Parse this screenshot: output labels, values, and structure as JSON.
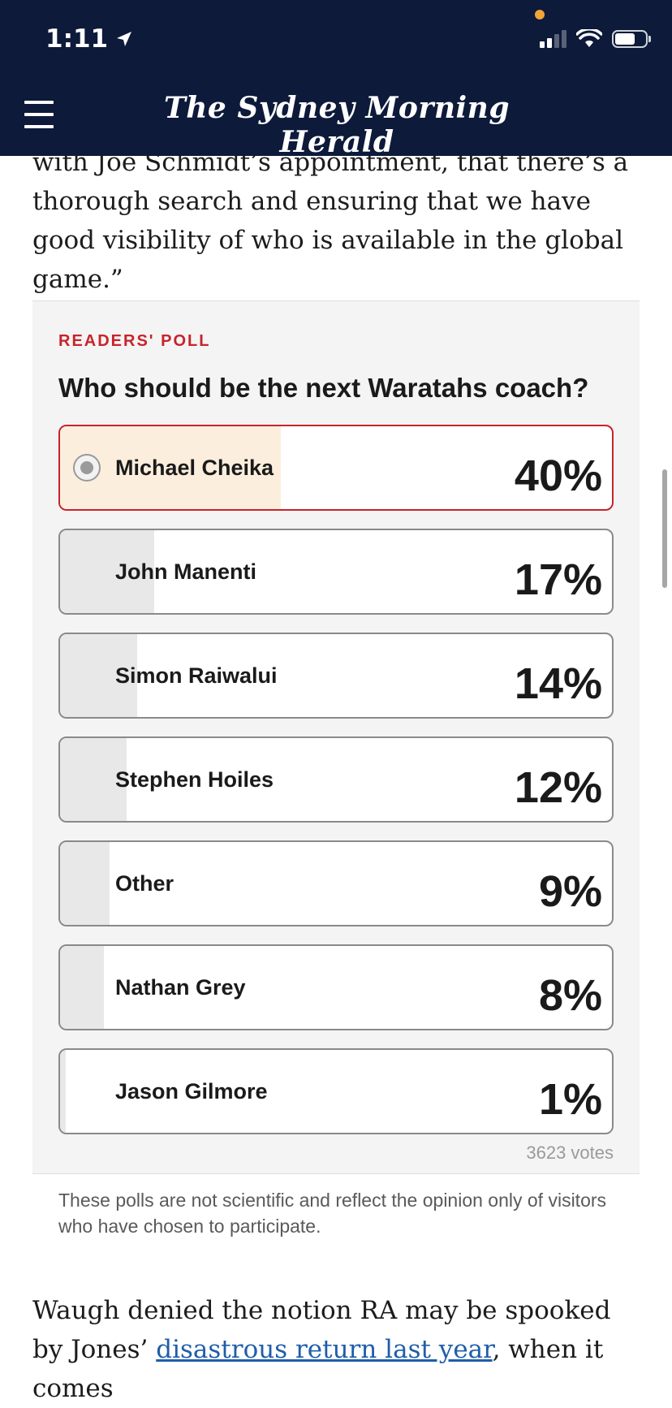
{
  "status_bar": {
    "time": "1:11"
  },
  "header": {
    "masthead": "The Sydney Morning Herald"
  },
  "article": {
    "top_text": "with Joe Schmidt’s appointment, that there’s a thorough search and ensuring that we have good visibility of who is available in the global game.”",
    "bottom_text_before": "Waugh denied the notion RA may be spooked by Jones’ ",
    "bottom_link": "disastrous return last year",
    "bottom_text_after": ", when it comes"
  },
  "poll": {
    "kicker": "READERS' POLL",
    "question": "Who should be the next Waratahs coach?",
    "options": [
      {
        "label": "Michael Cheika",
        "percent": "40%",
        "value": 0.4,
        "selected": true
      },
      {
        "label": "John Manenti",
        "percent": "17%",
        "value": 0.17,
        "selected": false
      },
      {
        "label": "Simon Raiwalui",
        "percent": "14%",
        "value": 0.14,
        "selected": false
      },
      {
        "label": "Stephen Hoiles",
        "percent": "12%",
        "value": 0.12,
        "selected": false
      },
      {
        "label": "Other",
        "percent": "9%",
        "value": 0.09,
        "selected": false
      },
      {
        "label": "Nathan Grey",
        "percent": "8%",
        "value": 0.08,
        "selected": false
      },
      {
        "label": "Jason Gilmore",
        "percent": "1%",
        "value": 0.01,
        "selected": false
      }
    ],
    "votes": "3623 votes",
    "disclaimer": "These polls are not scientific and reflect the opinion only of visitors who have chosen to participate."
  },
  "colors": {
    "header_bg": "#0d1a3a",
    "accent_red": "#c8232c",
    "selected_fill": "#fbeedd",
    "bar_fill": "#e8e8e8",
    "link": "#1f5ea8"
  },
  "icons": [
    "location-arrow-icon",
    "signal-icon",
    "wifi-icon",
    "battery-icon",
    "hamburger-menu-icon",
    "radio-selected-icon"
  ]
}
